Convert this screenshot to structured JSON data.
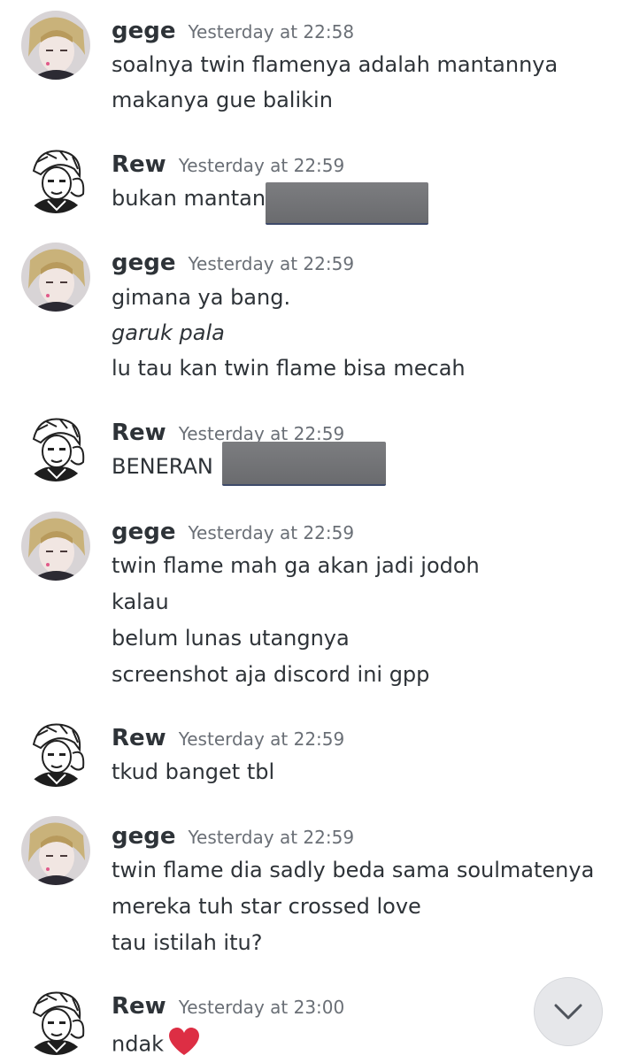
{
  "messages": [
    {
      "author": "gege",
      "time": "Yesterday at 22:58",
      "lines": [
        "soalnya twin flamenya adalah mantannya",
        "makanya gue balikin"
      ]
    },
    {
      "author": "Rew",
      "time": "Yesterday at 22:59",
      "lines": [
        "bukan mantan"
      ]
    },
    {
      "author": "gege",
      "time": "Yesterday at 22:59",
      "lines": [
        "gimana ya bang.",
        "garuk pala",
        "lu tau kan twin flame bisa mecah"
      ]
    },
    {
      "author": "Rew",
      "time": "Yesterday at 22:59",
      "lines": [
        "BENERAN"
      ]
    },
    {
      "author": "gege",
      "time": "Yesterday at 22:59",
      "lines": [
        "twin flame mah ga akan jadi jodoh",
        "kalau",
        "belum lunas utangnya",
        "screenshot aja discord ini gpp"
      ]
    },
    {
      "author": "Rew",
      "time": "Yesterday at 22:59",
      "lines": [
        "tkud banget tbl"
      ]
    },
    {
      "author": "gege",
      "time": "Yesterday at 22:59",
      "lines": [
        "twin flame dia sadly beda sama soulmatenya",
        "mereka tuh star crossed love",
        "tau istilah itu?"
      ]
    },
    {
      "author": "Rew",
      "time": "Yesterday at 23:00",
      "lines": [
        "ndak"
      ]
    }
  ],
  "icons": {
    "heart": "heart-emoji",
    "scroll": "chevron-down-icon"
  },
  "colors": {
    "heart": "#dd2e44",
    "redaction": "#747578"
  }
}
